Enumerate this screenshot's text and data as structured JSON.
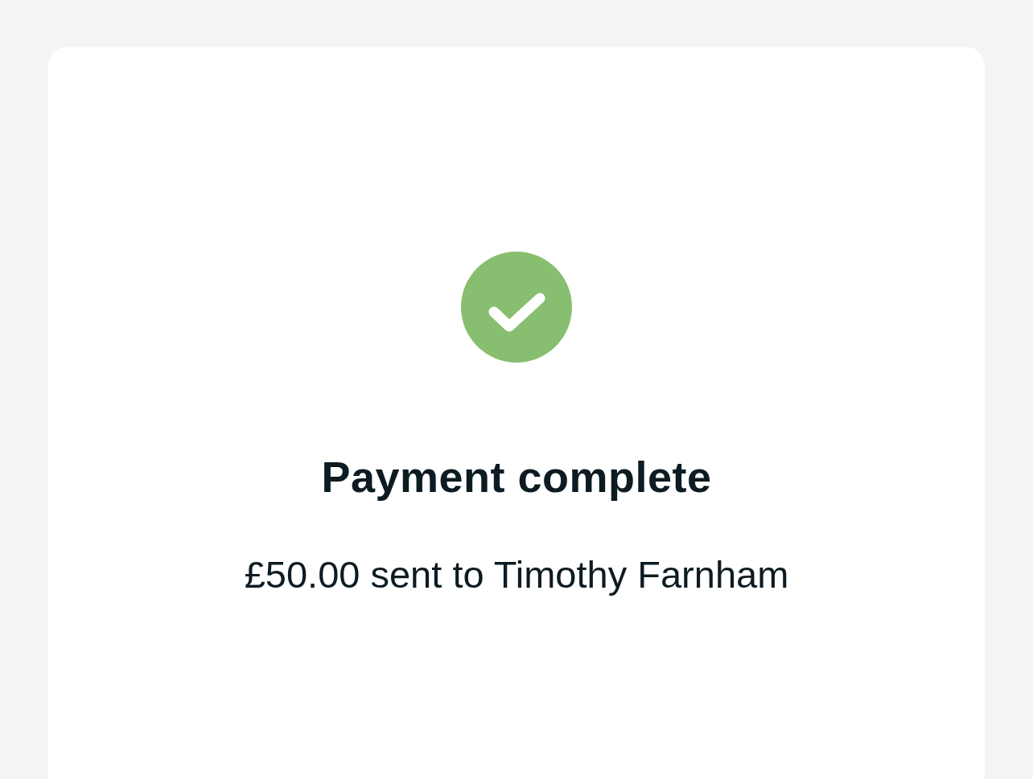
{
  "confirmation": {
    "title": "Payment complete",
    "message": "£50.00 sent to Timothy Farnham"
  }
}
